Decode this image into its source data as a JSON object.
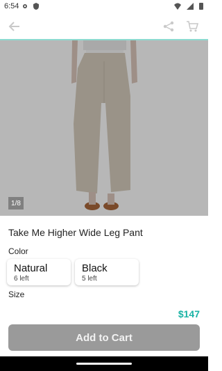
{
  "status": {
    "time": "6:54"
  },
  "product": {
    "title": "Take Me Higher Wide Leg Pant",
    "image_counter": "1/8",
    "price": "$147"
  },
  "options": {
    "color_label": "Color",
    "size_label": "Size",
    "colors": [
      {
        "name": "Natural",
        "stock": "6 left"
      },
      {
        "name": "Black",
        "stock": "5 left"
      }
    ]
  },
  "actions": {
    "add_to_cart": "Add to Cart"
  },
  "colors": {
    "accent": "#19b3a5",
    "button_bg": "#9a9a9a"
  }
}
